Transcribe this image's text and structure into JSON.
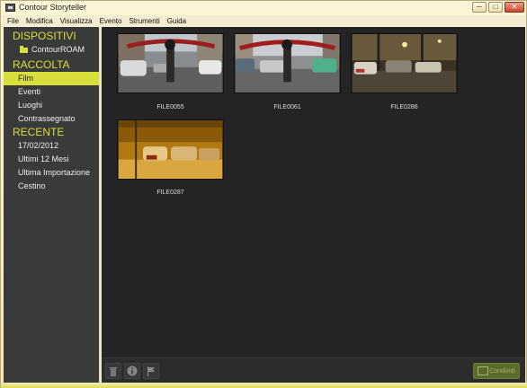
{
  "window": {
    "title": "Contour Storyteller",
    "minimize": "─",
    "maximize": "□",
    "close": "✕"
  },
  "menu": [
    "File",
    "Modifica",
    "Visualizza",
    "Evento",
    "Strumenti",
    "Guida"
  ],
  "sidebar": {
    "devices_header": "DISPOSITIVI",
    "device": "ContourROAM",
    "collection_header": "RACCOLTA",
    "collection_items": [
      "Film",
      "Eventi",
      "Luoghi",
      "Contrassegnato"
    ],
    "recent_header": "RECENTE",
    "recent_items": [
      "17/02/2012",
      "Ultimi 12 Mesi",
      "Ultima Importazione",
      "Cestino"
    ]
  },
  "thumbnails": [
    {
      "label": "FILE0055",
      "scene": "day-street"
    },
    {
      "label": "FILE0061",
      "scene": "day-street-2"
    },
    {
      "label": "FILE0286",
      "scene": "night-snow"
    },
    {
      "label": "FILE0287",
      "scene": "night-orange"
    }
  ],
  "toolbar": {
    "trash_icon": "trash-icon",
    "info_icon": "info-icon",
    "flag_icon": "flag-icon",
    "share_label": "Condividi"
  },
  "colors": {
    "accent": "#d8df3a",
    "sidebar_bg": "#3a3a3a",
    "content_bg": "#242424"
  }
}
